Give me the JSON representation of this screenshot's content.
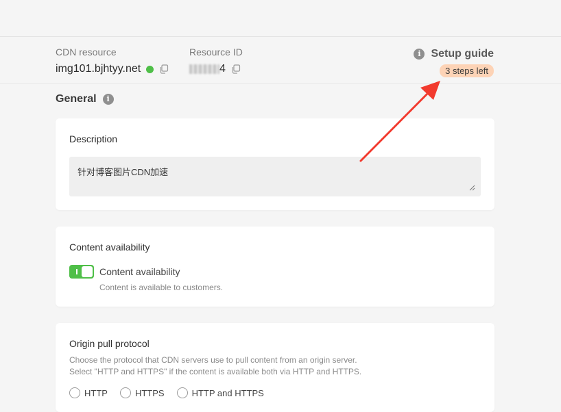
{
  "header": {
    "cdn_resource_label": "CDN resource",
    "cdn_resource_value": "img101.bjhtyy.net",
    "resource_id_label": "Resource ID",
    "resource_id_suffix": "4"
  },
  "setup_guide": {
    "title": "Setup guide",
    "badge": "3 steps left"
  },
  "general": {
    "title": "General"
  },
  "description_card": {
    "title": "Description",
    "value": "针对博客图片CDN加速"
  },
  "availability_card": {
    "title": "Content availability",
    "toggle_label": "Content availability",
    "toggle_help": "Content is available to customers.",
    "enabled": true
  },
  "origin_card": {
    "title": "Origin pull protocol",
    "help_line1": "Choose the protocol that CDN servers use to pull content from an origin server.",
    "help_line2": "Select \"HTTP and HTTPS\" if the content is available both via HTTP and HTTPS.",
    "options": [
      "HTTP",
      "HTTPS",
      "HTTP and HTTPS"
    ]
  },
  "colors": {
    "accent_green": "#4fbf48",
    "badge_bg": "#fdd3b6",
    "arrow_red": "#f23a2e"
  },
  "icons": [
    "copy-icon",
    "info-icon",
    "status-dot"
  ]
}
